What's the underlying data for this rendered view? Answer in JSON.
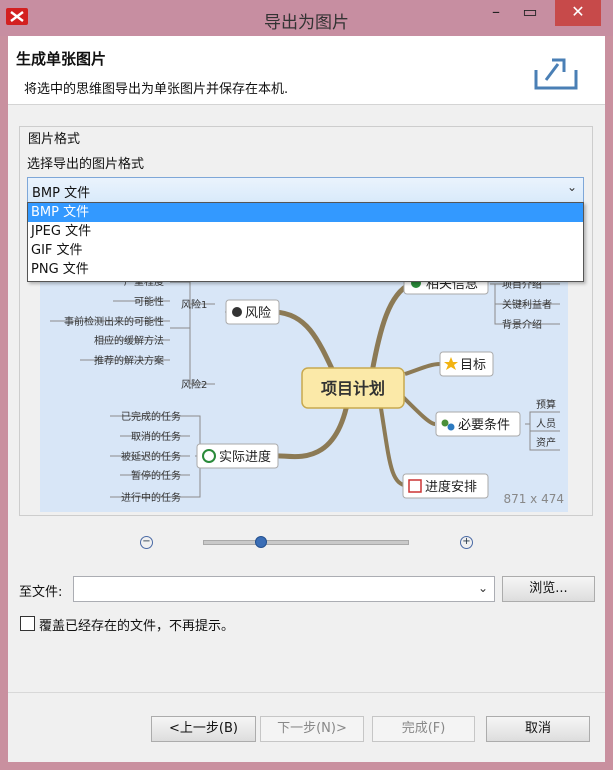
{
  "window": {
    "title": "导出为图片"
  },
  "header": {
    "title": "生成单张图片",
    "description": "将选中的思维图导出为单张图片并保存在本机."
  },
  "format_group": {
    "title": "图片格式",
    "label": "选择导出的图片格式",
    "selected": "BMP 文件",
    "options": [
      "BMP 文件",
      "JPEG 文件",
      "GIF 文件",
      "PNG 文件"
    ]
  },
  "preview": {
    "dimensions": "871 x 474",
    "nodes": {
      "central": "项目计划",
      "risk": "风险",
      "risk1": "风险1",
      "risk2": "风险2",
      "risk_items": [
        "严重程度",
        "可能性",
        "事前检测出来的可能性",
        "相应的缓解方法",
        "推荐的解决方案"
      ],
      "progress": "实际进度",
      "progress_items": [
        "已完成的任务",
        "取消的任务",
        "被延迟的任务",
        "暂停的任务",
        "进行中的任务"
      ],
      "info": "相关信息",
      "info_items": [
        "项目介绍",
        "关键利益者",
        "背景介绍"
      ],
      "goal": "目标",
      "requirements": "必要条件",
      "requirement_items": [
        "预算",
        "人员",
        "资产"
      ],
      "schedule": "进度安排"
    }
  },
  "zoom": {
    "level": 0.28
  },
  "to_file": {
    "label": "至文件:",
    "value": "",
    "browse": "浏览..."
  },
  "overwrite": {
    "label": "覆盖已经存在的文件，不再提示。",
    "checked": false
  },
  "buttons": {
    "back": "<上一步(B)",
    "next": "下一步(N)>",
    "finish": "完成(F)",
    "cancel": "取消"
  }
}
